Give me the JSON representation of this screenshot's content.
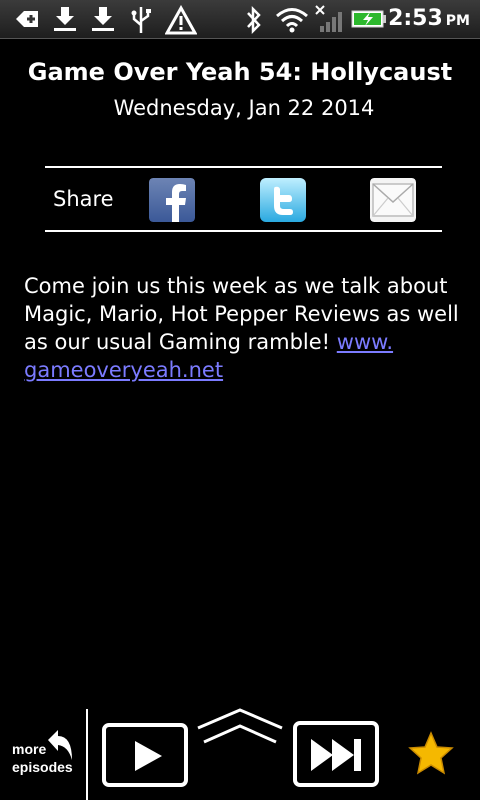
{
  "status_bar": {
    "time": "2:53",
    "ampm": "PM",
    "icons": [
      "usb-debug-icon",
      "download-icon",
      "download-icon",
      "usb-icon",
      "warning-icon",
      "bluetooth-icon",
      "wifi-icon",
      "no-signal-icon",
      "battery-charging-icon"
    ]
  },
  "episode": {
    "title": "Game Over Yeah 54: Hollycaust",
    "date": "Wednesday, Jan 22 2014",
    "description": "Come join us this week as we talk about Magic, Mario, Hot Pepper Reviews as well as our usual Gaming ramble! ",
    "link_line1": "www.",
    "link_line2": "gameoveryeah.net"
  },
  "share": {
    "label": "Share",
    "targets": [
      "facebook",
      "twitter",
      "email"
    ]
  },
  "controls": {
    "more_line1": "more",
    "more_line2": "episodes"
  },
  "colors": {
    "background": "#000000",
    "text": "#ffffff",
    "link": "#7b7bff",
    "star": "#f5b800",
    "facebook": "#3b5998",
    "twitter": "#33ccff"
  }
}
